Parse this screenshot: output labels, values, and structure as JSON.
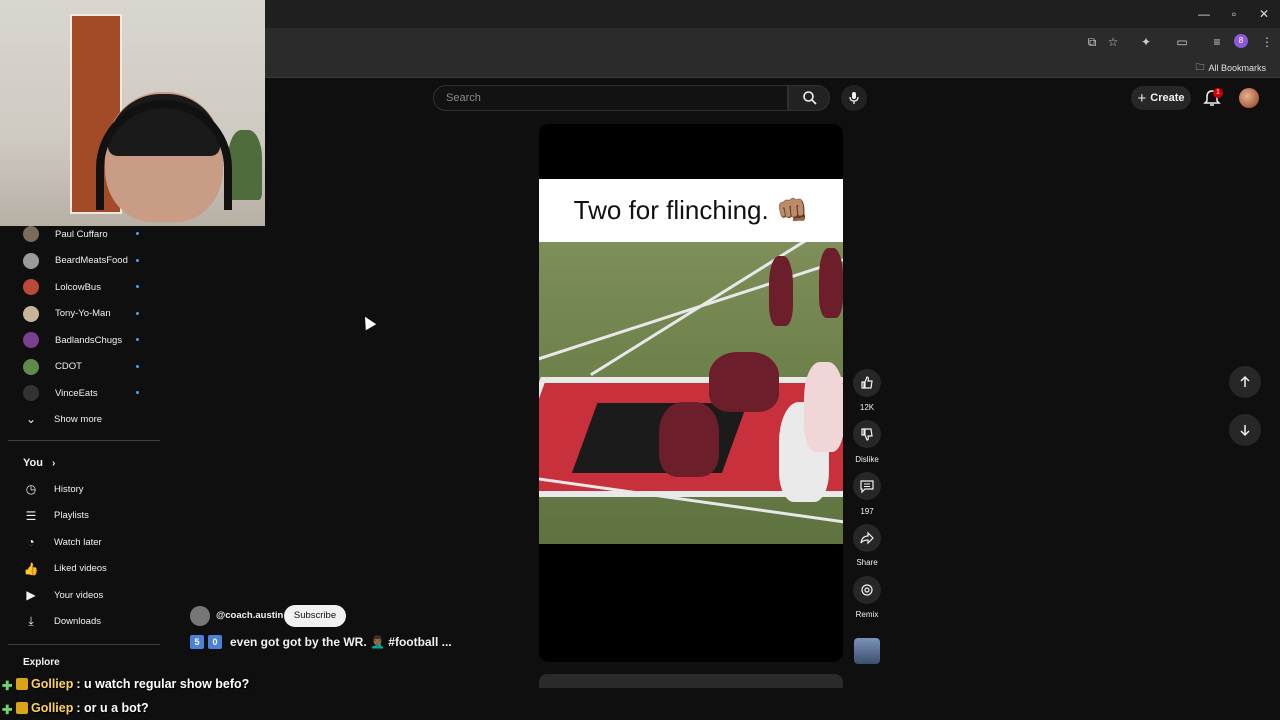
{
  "browser": {
    "bookmarks_label": "All Bookmarks",
    "profile_initial": "8"
  },
  "header": {
    "search_placeholder": "Search",
    "create_label": "Create",
    "notification_count": "1"
  },
  "sidebar": {
    "subscriptions": [
      {
        "label": "Paul Cuffaro",
        "color": "#7a6b5a"
      },
      {
        "label": "BeardMeatsFood",
        "color": "#9a9a9a"
      },
      {
        "label": "LolcowBus",
        "color": "#b94a3a"
      },
      {
        "label": "Tony-Yo-Man",
        "color": "#c7b59a"
      },
      {
        "label": "BadlandsChugs",
        "color": "#7a3f8f"
      },
      {
        "label": "CDOT",
        "color": "#5f8a4a"
      },
      {
        "label": "VinceEats",
        "color": "#333333"
      }
    ],
    "show_more": "Show more",
    "you_header": "You",
    "you_items": [
      {
        "label": "History",
        "icon": "history-icon"
      },
      {
        "label": "Playlists",
        "icon": "playlists-icon"
      },
      {
        "label": "Watch later",
        "icon": "watch-later-icon"
      },
      {
        "label": "Liked videos",
        "icon": "liked-videos-icon"
      },
      {
        "label": "Your videos",
        "icon": "your-videos-icon"
      },
      {
        "label": "Downloads",
        "icon": "downloads-icon"
      }
    ],
    "explore_header": "Explore"
  },
  "short": {
    "caption": "Two for flinching. 👊🏽",
    "channel": "@coach.austin",
    "subscribe_label": "Subscribe",
    "description_digits": [
      "5",
      "0"
    ],
    "description": "even got got by the WR. 🤦🏾‍♂️ #football ..."
  },
  "actions": {
    "like_count": "12K",
    "dislike_label": "Dislike",
    "comment_count": "197",
    "share_label": "Share",
    "remix_label": "Remix"
  },
  "chat": [
    {
      "user": "Golliер",
      "message": ": u watch regular show befo?"
    },
    {
      "user": "Golliер",
      "message": ": or u a bot?"
    }
  ]
}
